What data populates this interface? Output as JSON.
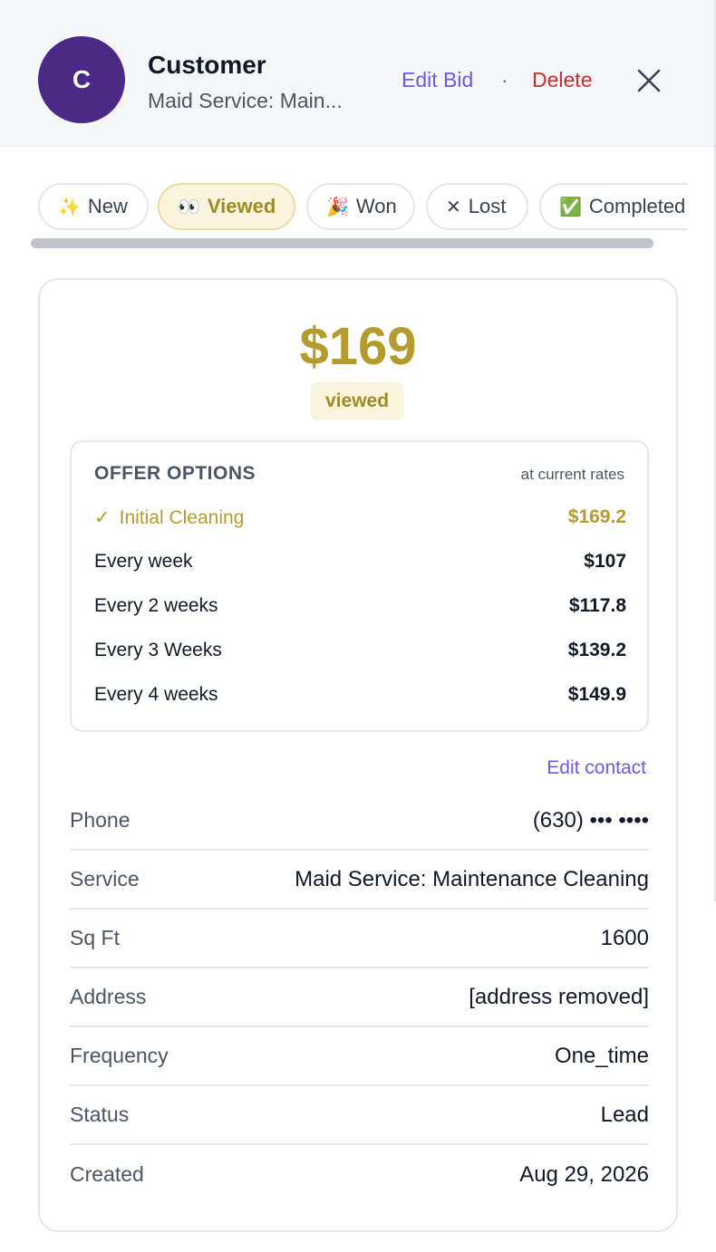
{
  "header": {
    "avatar_initial": "C",
    "customer_name": "Customer",
    "subtitle": "Maid Service: Main...",
    "edit_bid_label": "Edit Bid",
    "separator": "·",
    "delete_label": "Delete",
    "close_icon": "close-icon"
  },
  "status_chips": [
    {
      "emoji": "✨",
      "label": "New",
      "active": false
    },
    {
      "emoji": "👀",
      "label": "Viewed",
      "active": true
    },
    {
      "emoji": "🎉",
      "label": "Won",
      "active": false
    },
    {
      "emoji": "✕",
      "label": "Lost",
      "active": false
    },
    {
      "emoji": "✅",
      "label": "Completed",
      "active": false
    }
  ],
  "bid": {
    "price": "$169",
    "status": "viewed"
  },
  "offers": {
    "title": "OFFER OPTIONS",
    "note": "at current rates",
    "selected_mark": "✓",
    "items": [
      {
        "label": "Initial Cleaning",
        "price": "$169.2",
        "selected": true
      },
      {
        "label": "Every week",
        "price": "$107",
        "selected": false
      },
      {
        "label": "Every 2 weeks",
        "price": "$117.8",
        "selected": false
      },
      {
        "label": "Every 3 Weeks",
        "price": "$139.2",
        "selected": false
      },
      {
        "label": "Every 4 weeks",
        "price": "$149.9",
        "selected": false
      }
    ]
  },
  "contact": {
    "edit_label": "Edit contact",
    "details": [
      {
        "label": "Phone",
        "value": "(630) ••• ••••"
      },
      {
        "label": "Service",
        "value": "Maid Service: Maintenance Cleaning"
      },
      {
        "label": "Sq Ft",
        "value": "1600"
      },
      {
        "label": "Address",
        "value": "[address removed]"
      },
      {
        "label": "Frequency",
        "value": "One_time"
      },
      {
        "label": "Status",
        "value": "Lead"
      },
      {
        "label": "Created",
        "value": "Aug 29, 2026"
      }
    ]
  },
  "colors": {
    "accent_purple": "#7357e6",
    "delete_red": "#cc2e2e",
    "gold": "#b59a2c",
    "avatar_bg": "#4a2a86"
  }
}
